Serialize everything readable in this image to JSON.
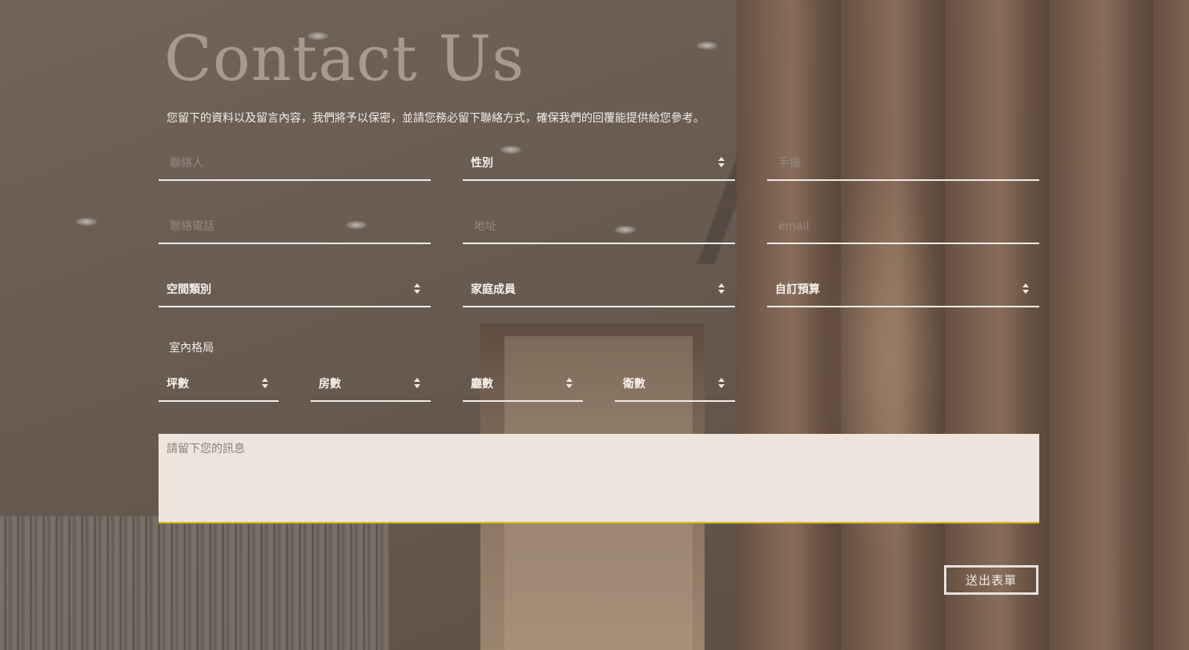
{
  "page": {
    "title": "Contact Us",
    "intro": "您留下的資料以及留言內容，我們將予以保密，並請您務必留下聯絡方式，確保我們的回覆能提供給您參考。"
  },
  "form": {
    "contact_name": {
      "placeholder": "聯絡人"
    },
    "gender": {
      "selected": "性別"
    },
    "mobile": {
      "placeholder": "手機"
    },
    "phone": {
      "placeholder": "聯絡電話"
    },
    "address": {
      "placeholder": "地址"
    },
    "email": {
      "placeholder": "email"
    },
    "space_type": {
      "selected": "空間類別"
    },
    "family_members": {
      "selected": "家庭成員"
    },
    "budget": {
      "selected": "自訂預算"
    },
    "layout_label": "室內格局",
    "ping": {
      "selected": "坪數"
    },
    "rooms": {
      "selected": "房數"
    },
    "halls": {
      "selected": "廳數"
    },
    "baths": {
      "selected": "衛數"
    },
    "message": {
      "placeholder": "請留下您的訊息"
    },
    "submit_label": "送出表單"
  },
  "colors": {
    "accent_underline": "#d8b521",
    "field_line": "#f1ebe4",
    "title": "#a69a90"
  }
}
